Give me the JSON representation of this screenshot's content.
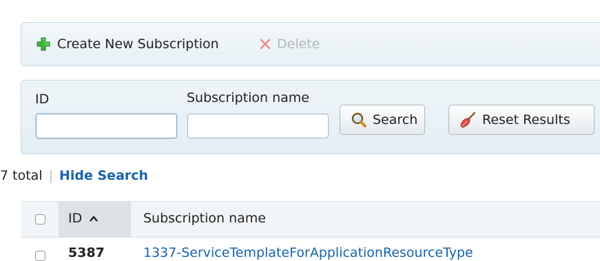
{
  "toolbar": {
    "create_label": "Create New Subscription",
    "delete_label": "Delete"
  },
  "search": {
    "id_label": "ID",
    "id_value": "",
    "name_label": "Subscription name",
    "name_value": "",
    "search_button": "Search",
    "reset_button": "Reset Results"
  },
  "summary": {
    "total": "7 total",
    "separator": "|",
    "hide_search": "Hide Search"
  },
  "table": {
    "columns": [
      "ID",
      "Subscription name"
    ],
    "sort_column": "ID",
    "sort_direction": "ascending",
    "rows": [
      {
        "id": "5387",
        "name": "1337-ServiceTemplateForApplicationResourceType"
      }
    ]
  },
  "colors": {
    "link": "#1763ad",
    "accent_green": "#3bb53b",
    "delete_disabled": "#b2b9be",
    "panel_bg": "#e6f0f5"
  },
  "icons": [
    "plus-icon",
    "x-icon",
    "magnifier-icon",
    "broom-icon",
    "caret-up-icon"
  ]
}
